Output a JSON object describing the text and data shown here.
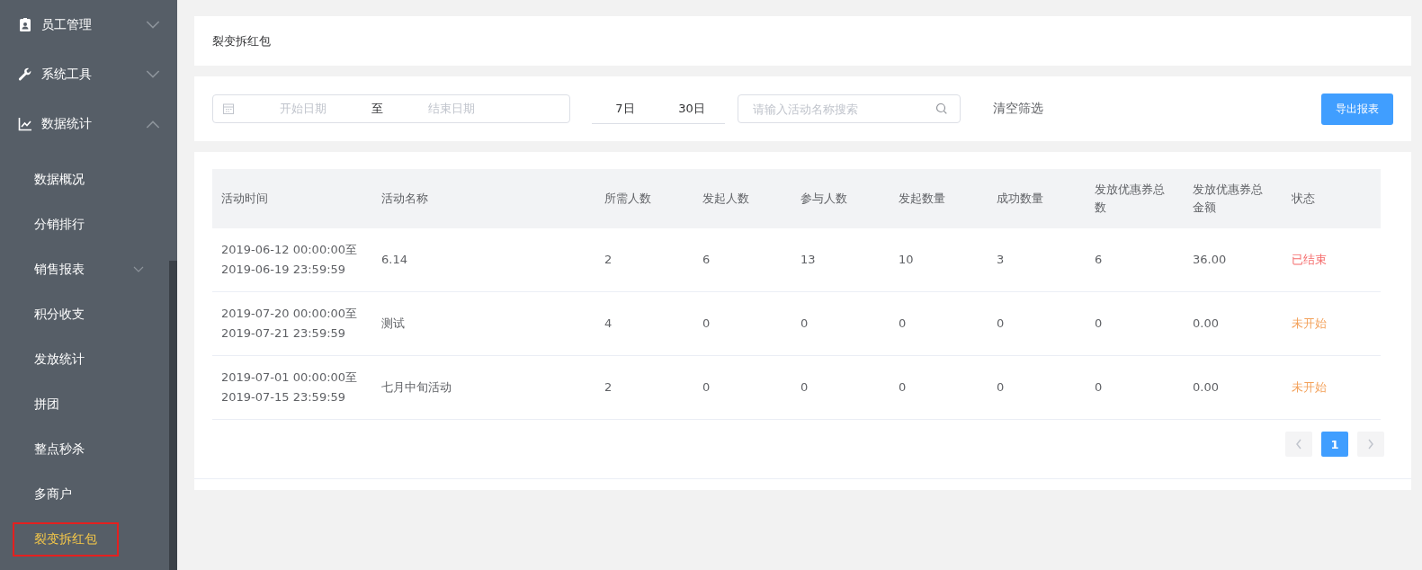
{
  "sidebar": {
    "items": [
      {
        "label": "员工管理",
        "expanded": false,
        "selected": false
      },
      {
        "label": "系统工具",
        "expanded": false,
        "selected": false
      },
      {
        "label": "数据统计",
        "expanded": true,
        "selected": false,
        "children": [
          {
            "label": "数据概况",
            "selected": false
          },
          {
            "label": "分销排行",
            "selected": false
          },
          {
            "label": "销售报表",
            "selected": false,
            "expanded": false
          },
          {
            "label": "积分收支",
            "selected": false
          },
          {
            "label": "发放统计",
            "selected": false
          },
          {
            "label": "拼团",
            "selected": false
          },
          {
            "label": "整点秒杀",
            "selected": false
          },
          {
            "label": "多商户",
            "selected": false
          },
          {
            "label": "裂变拆红包",
            "selected": true
          }
        ]
      }
    ]
  },
  "page_title": "裂变拆红包",
  "filters": {
    "start_date": {
      "placeholder": "开始日期"
    },
    "range_separator": "至",
    "end_date": {
      "placeholder": "结束日期"
    },
    "quick_ranges": [
      "7日",
      "30日"
    ],
    "search": {
      "placeholder": "请输入活动名称搜索"
    },
    "clear_label": "清空筛选",
    "export_label": "导出报表"
  },
  "table": {
    "columns": [
      "活动时间",
      "活动名称",
      "所需人数",
      "发起人数",
      "参与人数",
      "发起数量",
      "成功数量",
      "发放优惠券总数",
      "发放优惠券总金额",
      "状态"
    ],
    "rows": [
      {
        "cells": [
          "2019-06-12 00:00:00至\n2019-06-19 23:59:59",
          "6.14",
          "2",
          "6",
          "13",
          "10",
          "3",
          "6",
          "36.00",
          "已结束"
        ],
        "color": "#f56c6c"
      },
      {
        "cells": [
          "2019-07-20 00:00:00至\n2019-07-21 23:59:59",
          "测试",
          "4",
          "0",
          "0",
          "0",
          "0",
          "0",
          "0.00",
          "未开始"
        ],
        "color": "#f3a15a"
      },
      {
        "cells": [
          "2019-07-01 00:00:00至\n2019-07-15 23:59:59",
          "七月中旬活动",
          "2",
          "0",
          "0",
          "0",
          "0",
          "0",
          "0.00",
          "未开始"
        ],
        "color": "#f3a15a"
      }
    ]
  },
  "pagination": {
    "prev_disabled": true,
    "pages": [
      {
        "label": "1",
        "selected": true
      }
    ],
    "next_disabled": true
  }
}
